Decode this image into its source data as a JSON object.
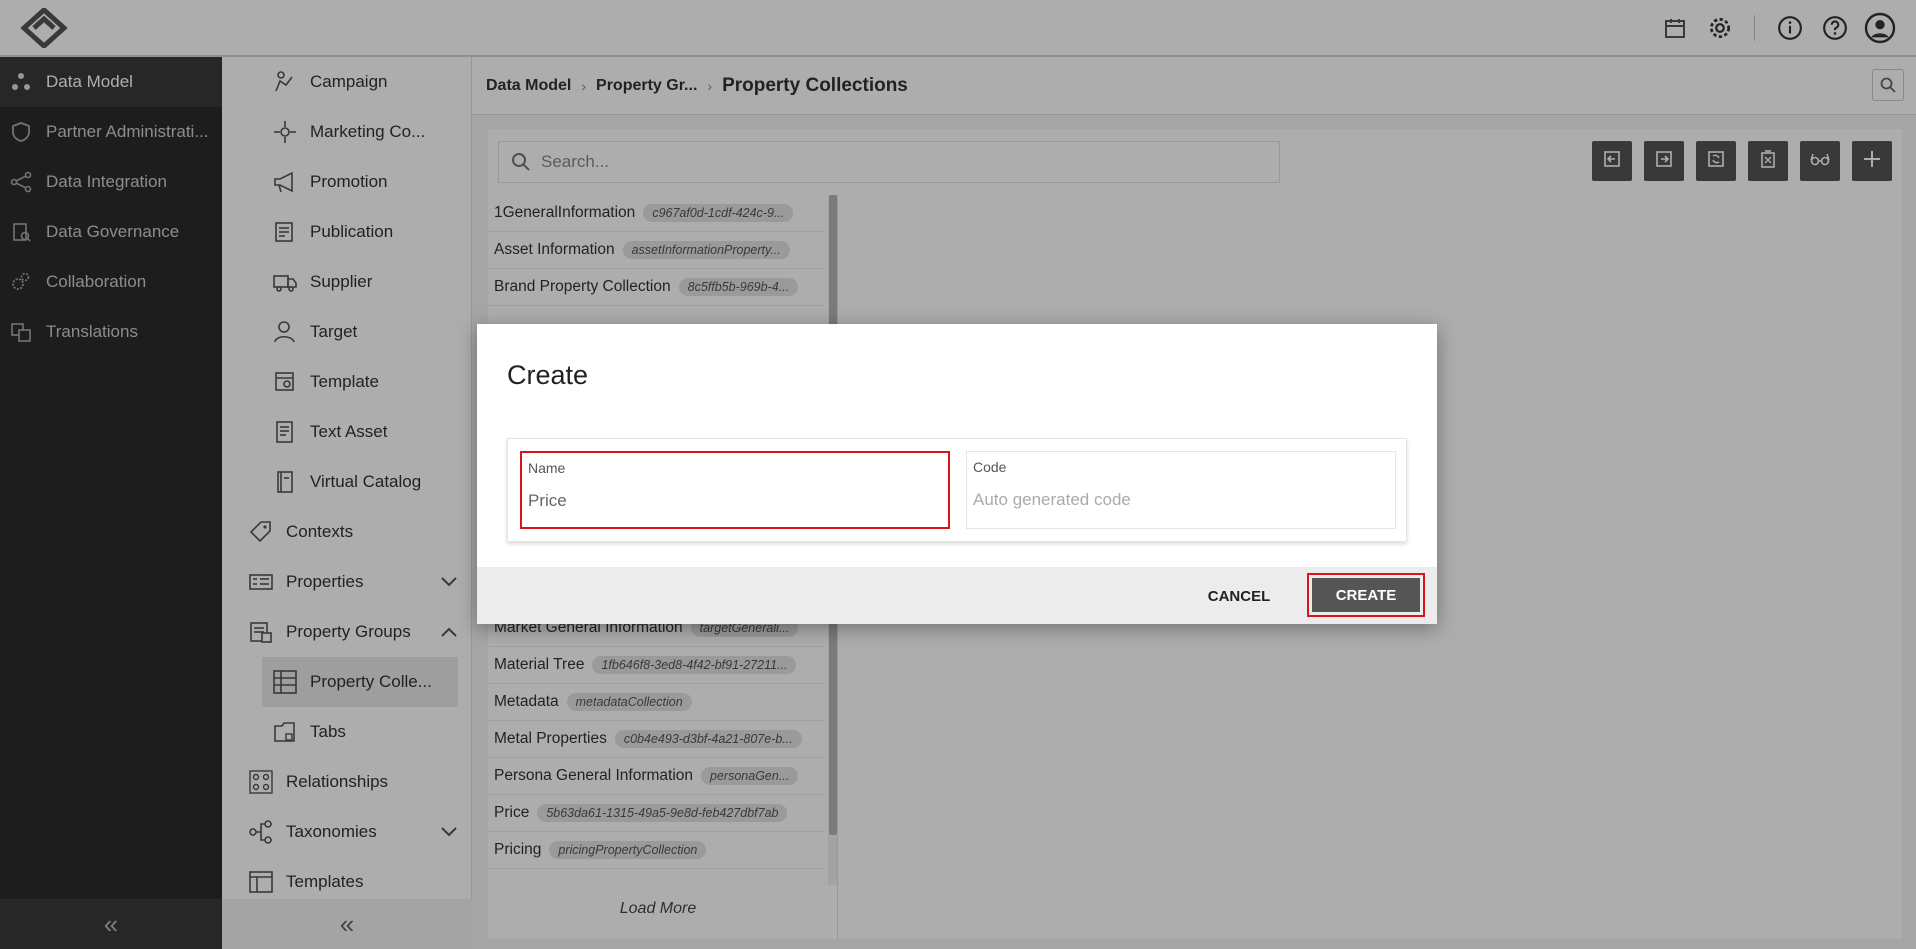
{
  "topbar": {
    "icons": [
      "calendar-icon",
      "gear-icon",
      "info-icon",
      "help-icon",
      "user-avatar-icon"
    ]
  },
  "leftnav": {
    "items": [
      {
        "label": "Data Model",
        "icon": "data-model-icon",
        "active": true
      },
      {
        "label": "Partner Administrati...",
        "icon": "shield-icon",
        "active": false
      },
      {
        "label": "Data Integration",
        "icon": "integration-icon",
        "active": false
      },
      {
        "label": "Data Governance",
        "icon": "governance-icon",
        "active": false
      },
      {
        "label": "Collaboration",
        "icon": "collaboration-icon",
        "active": false
      },
      {
        "label": "Translations",
        "icon": "translations-icon",
        "active": false
      }
    ],
    "collapse_glyph": "«"
  },
  "subnav": {
    "items": [
      {
        "label": "Campaign",
        "icon": "campaign-icon"
      },
      {
        "label": "Marketing Co...",
        "icon": "marketing-icon"
      },
      {
        "label": "Promotion",
        "icon": "megaphone-icon"
      },
      {
        "label": "Publication",
        "icon": "publication-icon"
      },
      {
        "label": "Supplier",
        "icon": "truck-icon"
      },
      {
        "label": "Target",
        "icon": "target-user-icon"
      },
      {
        "label": "Template",
        "icon": "template-icon"
      },
      {
        "label": "Text Asset",
        "icon": "text-asset-icon"
      },
      {
        "label": "Virtual Catalog",
        "icon": "catalog-icon"
      },
      {
        "label": "Contexts",
        "icon": "tag-icon"
      },
      {
        "label": "Properties",
        "icon": "properties-icon"
      },
      {
        "label": "Property Groups",
        "icon": "property-groups-icon"
      },
      {
        "label": "Property Colle...",
        "icon": "table-grid-icon"
      },
      {
        "label": "Tabs",
        "icon": "tabs-icon"
      },
      {
        "label": "Relationships",
        "icon": "relationships-icon"
      },
      {
        "label": "Taxonomies",
        "icon": "taxonomies-icon"
      },
      {
        "label": "Templates",
        "icon": "templates-icon"
      }
    ],
    "collapse_glyph": "«"
  },
  "breadcrumb": {
    "items": [
      "Data Model",
      "Property Gr..."
    ],
    "current": "Property Collections",
    "separator": "›"
  },
  "search": {
    "placeholder": "Search..."
  },
  "toolbar": {
    "buttons": [
      "import-icon",
      "export-icon",
      "refresh-icon",
      "delete-icon",
      "glasses-icon",
      "plus-icon"
    ]
  },
  "list": {
    "rows": [
      {
        "name": "1GeneralInformation",
        "code": "c967af0d-1cdf-424c-9..."
      },
      {
        "name": "Asset Information",
        "code": "assetInformationProperty..."
      },
      {
        "name": "Brand Property Collection",
        "code": "8c5ffb5b-969b-4..."
      },
      {
        "name": "Market General Information",
        "code": "targetGenerali..."
      },
      {
        "name": "Material Tree",
        "code": "1fb646f8-3ed8-4f42-bf91-27211..."
      },
      {
        "name": "Metadata",
        "code": "metadataCollection"
      },
      {
        "name": "Metal Properties",
        "code": "c0b4e493-d3bf-4a21-807e-b..."
      },
      {
        "name": "Persona General Information",
        "code": "personaGen..."
      },
      {
        "name": "Price",
        "code": "5b63da61-1315-49a5-9e8d-feb427dbf7ab"
      },
      {
        "name": "Pricing",
        "code": "pricingPropertyCollection"
      }
    ],
    "load_more": "Load More"
  },
  "dialog": {
    "title": "Create",
    "name_label": "Name",
    "name_value": "Price",
    "code_label": "Code",
    "code_placeholder": "Auto generated code",
    "cancel_label": "CANCEL",
    "create_label": "CREATE"
  },
  "colors": {
    "highlight": "#d9141f",
    "button_dark": "#555555",
    "nav_bg": "#2b2b2b"
  }
}
